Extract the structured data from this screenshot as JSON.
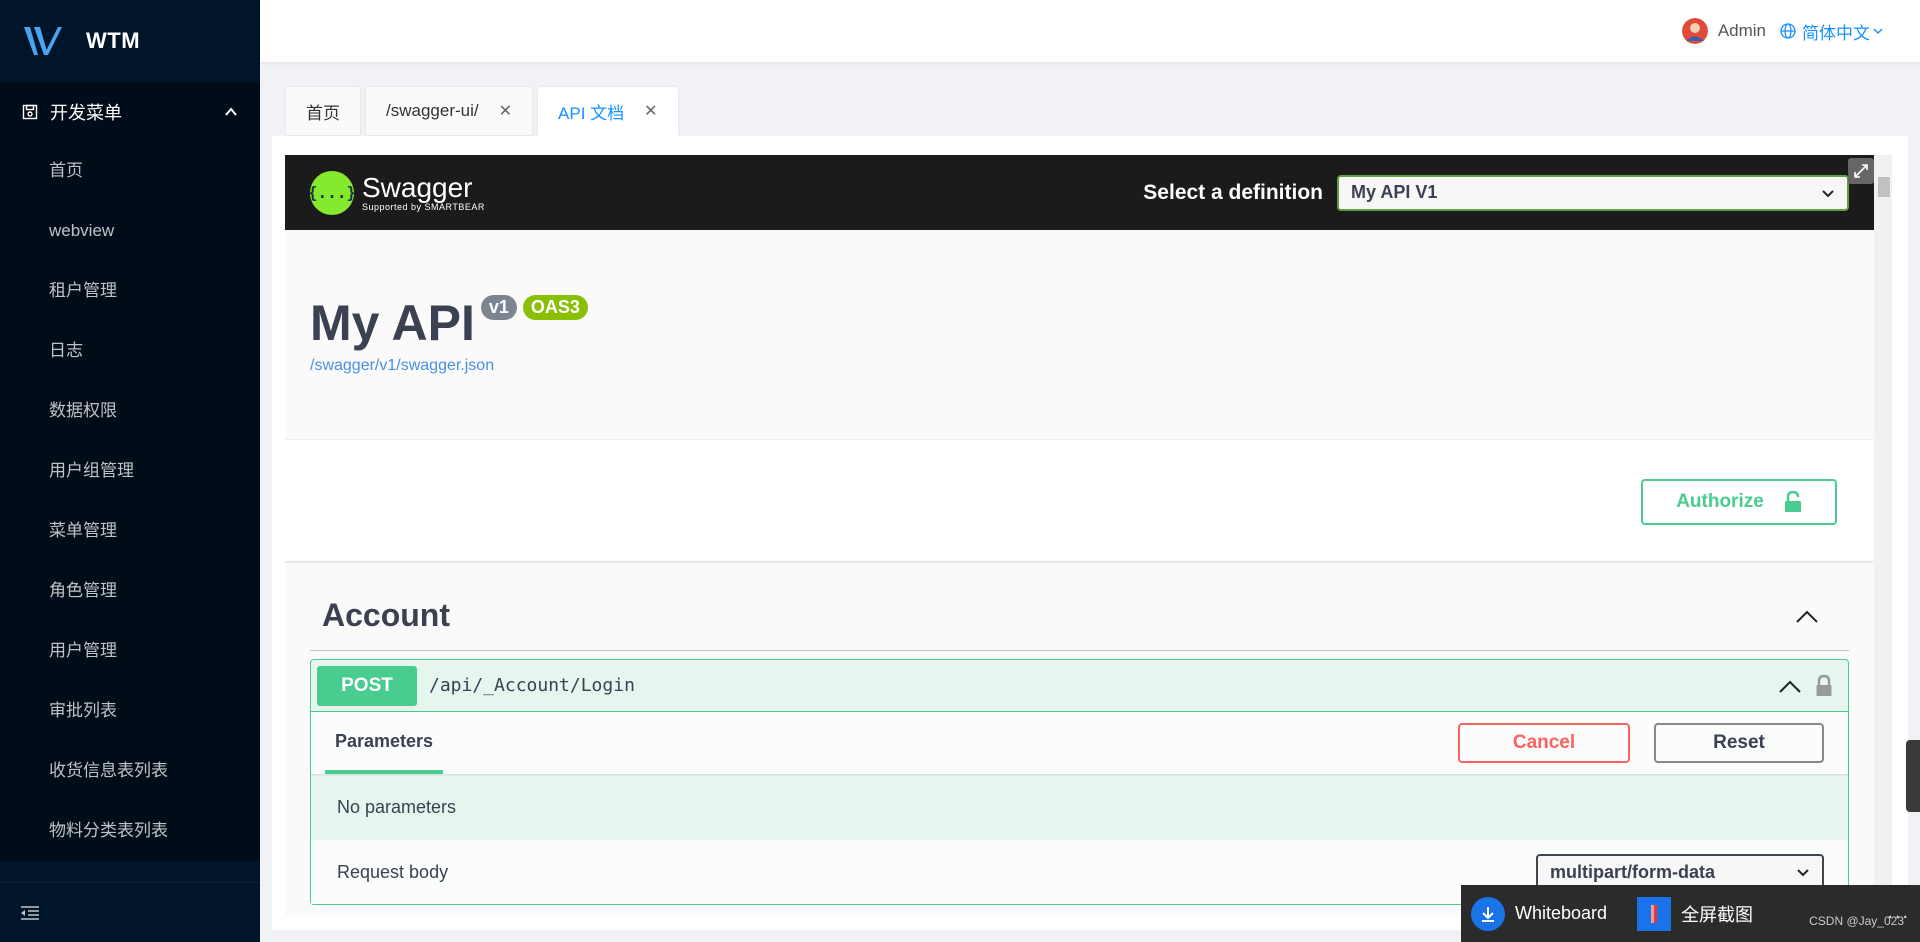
{
  "app": {
    "name": "WTM"
  },
  "sidebar": {
    "group_label": "开发菜单",
    "items": [
      {
        "label": "首页"
      },
      {
        "label": "webview"
      },
      {
        "label": "租户管理"
      },
      {
        "label": "日志"
      },
      {
        "label": "数据权限"
      },
      {
        "label": "用户组管理"
      },
      {
        "label": "菜单管理"
      },
      {
        "label": "角色管理"
      },
      {
        "label": "用户管理"
      },
      {
        "label": "审批列表"
      },
      {
        "label": "收货信息表列表"
      },
      {
        "label": "物料分类表列表"
      }
    ]
  },
  "header": {
    "username": "Admin",
    "language": "简体中文"
  },
  "tabs": [
    {
      "label": "首页",
      "closable": false
    },
    {
      "label": "/swagger-ui/",
      "closable": true
    },
    {
      "label": "API 文档",
      "closable": true,
      "active": true
    }
  ],
  "swagger": {
    "logo_name": "Swagger",
    "logo_sub": "Supported by SMARTBEAR",
    "logo_glyph": "{...}",
    "definition_label": "Select a definition",
    "definition_value": "My API V1",
    "api_title": "My API",
    "version_badge": "v1",
    "oas_badge": "OAS3",
    "spec_link": "/swagger/v1/swagger.json",
    "authorize_label": "Authorize",
    "tag_name": "Account",
    "operation": {
      "method": "POST",
      "path": "/api/_Account/Login",
      "params_tab": "Parameters",
      "cancel_label": "Cancel",
      "reset_label": "Reset",
      "no_params": "No parameters",
      "request_body_label": "Request body",
      "content_type": "multipart/form-data"
    }
  },
  "taskbar": {
    "whiteboard": "Whiteboard",
    "screenshot": "全屏截图",
    "more": "...",
    "watermark": "CSDN @Jay_023"
  },
  "colors": {
    "sidebar_bg": "#001529",
    "accent": "#1890ff",
    "swagger_green": "#49cc90",
    "cancel_red": "#ff6060"
  }
}
